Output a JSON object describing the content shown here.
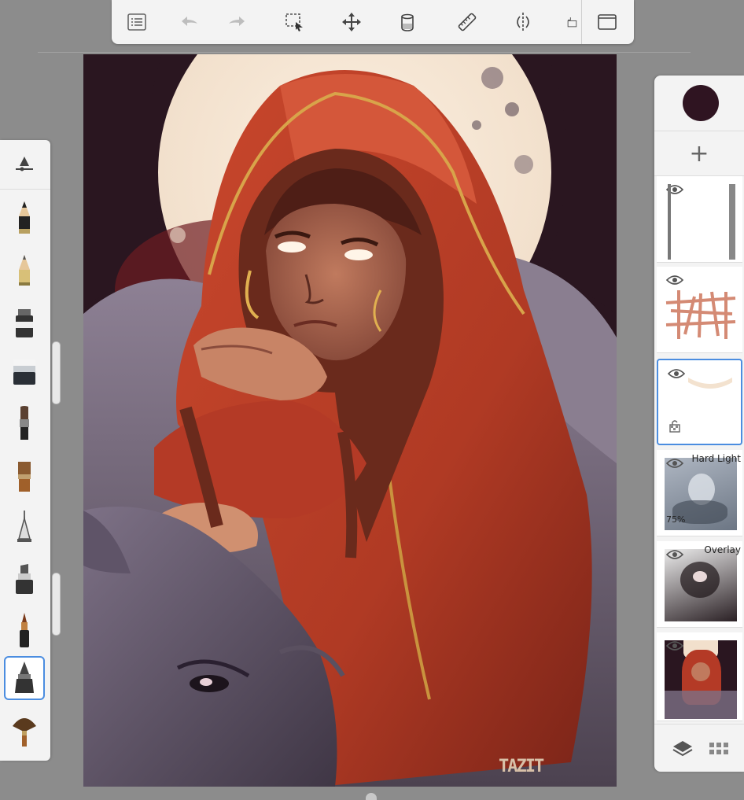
{
  "toolbar": {
    "icons": [
      "list-icon",
      "undo-icon",
      "redo-icon",
      "selection-icon",
      "transform-icon",
      "fill-bucket-icon",
      "ruler-icon",
      "symmetry-icon",
      "crop-icon",
      "fullscreen-icon"
    ]
  },
  "brushes": [
    "brush-settings-icon",
    "pencil-icon",
    "hard-pencil-icon",
    "marker-icon",
    "eraser-icon",
    "paint-brush-icon",
    "flat-brush-icon",
    "airbrush-icon",
    "chisel-marker-icon",
    "ink-pen-icon",
    "smudge-brush-icon",
    "fan-brush-icon"
  ],
  "selected_brush": "smudge-brush-icon",
  "colors": {
    "current_color": "#2f1421",
    "accent": "#4b8de0",
    "panel_bg": "#f3f3f3",
    "workspace_bg": "#8c8c8c"
  },
  "layers": [
    {
      "name": "layer-1",
      "blend": "",
      "opacity": "",
      "selected": false
    },
    {
      "name": "layer-2",
      "blend": "",
      "opacity": "",
      "selected": false
    },
    {
      "name": "layer-3",
      "blend": "",
      "opacity": "",
      "selected": true
    },
    {
      "name": "layer-4",
      "blend": "Hard Light",
      "opacity": "75%",
      "selected": false
    },
    {
      "name": "layer-5",
      "blend": "Overlay",
      "opacity": "",
      "selected": false
    },
    {
      "name": "layer-6",
      "blend": "",
      "opacity": "",
      "selected": false
    }
  ],
  "layers_footer": {
    "add_label": "+"
  },
  "canvas": {
    "signature": "TAZIT"
  }
}
